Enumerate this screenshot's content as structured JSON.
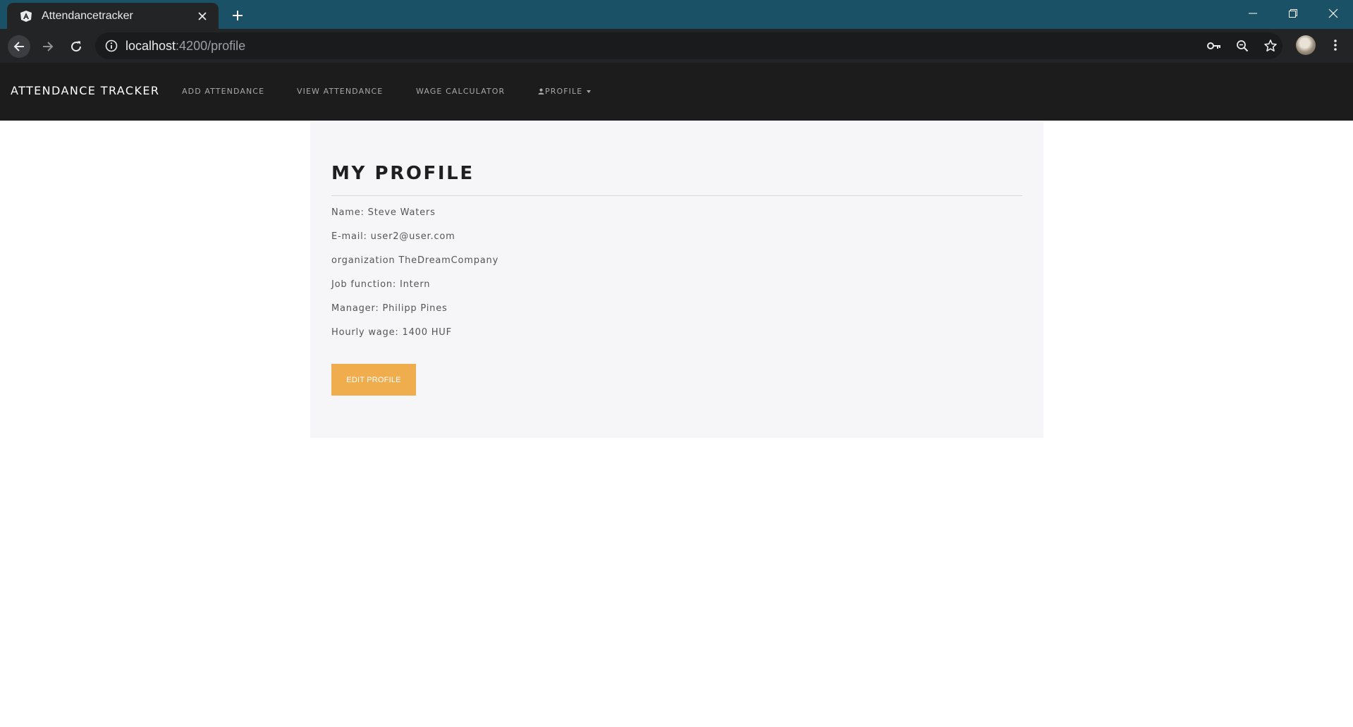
{
  "browser": {
    "tab_title": "Attendancetracker",
    "url_host": "localhost",
    "url_path": ":4200/profile",
    "icons": {
      "favicon": "angular-icon",
      "close": "close-icon",
      "new_tab": "plus-icon",
      "back": "back-arrow-icon",
      "forward": "forward-arrow-icon",
      "reload": "reload-icon",
      "site_info": "info-icon",
      "password": "key-icon",
      "zoom": "zoom-out-icon",
      "bookmark": "star-icon",
      "menu": "vertical-dots-icon"
    }
  },
  "navbar": {
    "brand": "ATTENDANCE TRACKER",
    "links": {
      "add_attendance": "ADD ATTENDANCE",
      "view_attendance": "VIEW ATTENDANCE",
      "wage_calculator": "WAGE CALCULATOR",
      "profile": "PROFILE"
    }
  },
  "profile": {
    "title": "MY PROFILE",
    "name": "Name: Steve Waters",
    "email": "E-mail: user2@user.com",
    "organization": "organization TheDreamCompany",
    "job_function": "Job function: Intern",
    "manager": "Manager: Philipp Pines",
    "hourly_wage": "Hourly wage: 1400 HUF",
    "edit_button": "EDIT PROFILE"
  },
  "colors": {
    "tabstrip": "#1b5166",
    "toolbar": "#232426",
    "navbar": "#1c1c1c",
    "card": "#f6f6f8",
    "accent_button": "#f0ad4e"
  }
}
